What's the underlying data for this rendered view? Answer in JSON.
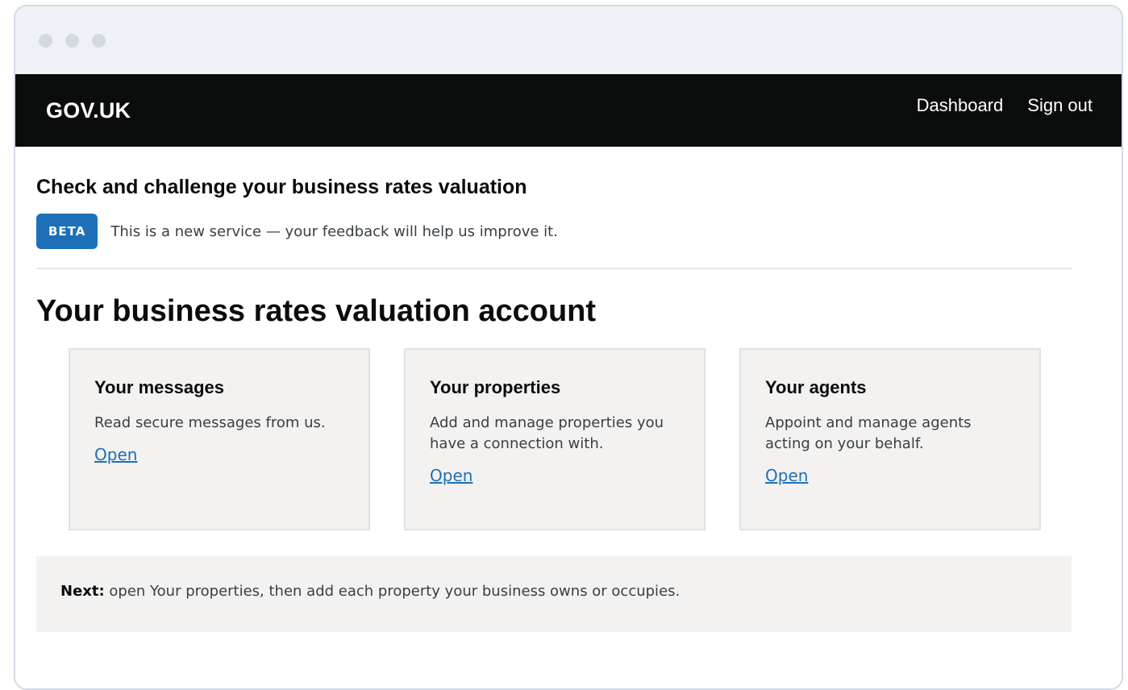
{
  "header": {
    "logo": "GOV.UK",
    "nav": [
      "Dashboard",
      "Sign out"
    ]
  },
  "service": {
    "name": "Check and challenge your business rates valuation",
    "phase_tag": "BETA",
    "phase_text": "This is a new service — your feedback will help us improve it."
  },
  "page": {
    "title": "Your business rates valuation account"
  },
  "cards": [
    {
      "title": "Your messages",
      "description": "Read secure messages from us.",
      "link": "Open"
    },
    {
      "title": "Your properties",
      "description": "Add and manage properties you have a connection with.",
      "link": "Open"
    },
    {
      "title": "Your agents",
      "description": "Appoint and manage agents acting on your behalf.",
      "link": "Open"
    }
  ],
  "next": {
    "label": "Next:",
    "text": " open Your properties, then add each property your business owns or occupies."
  },
  "colors": {
    "header_bg": "#0b0c0c",
    "link": "#1d70b8",
    "tag_bg": "#1d70b8",
    "panel_bg": "#f3f2f1"
  }
}
